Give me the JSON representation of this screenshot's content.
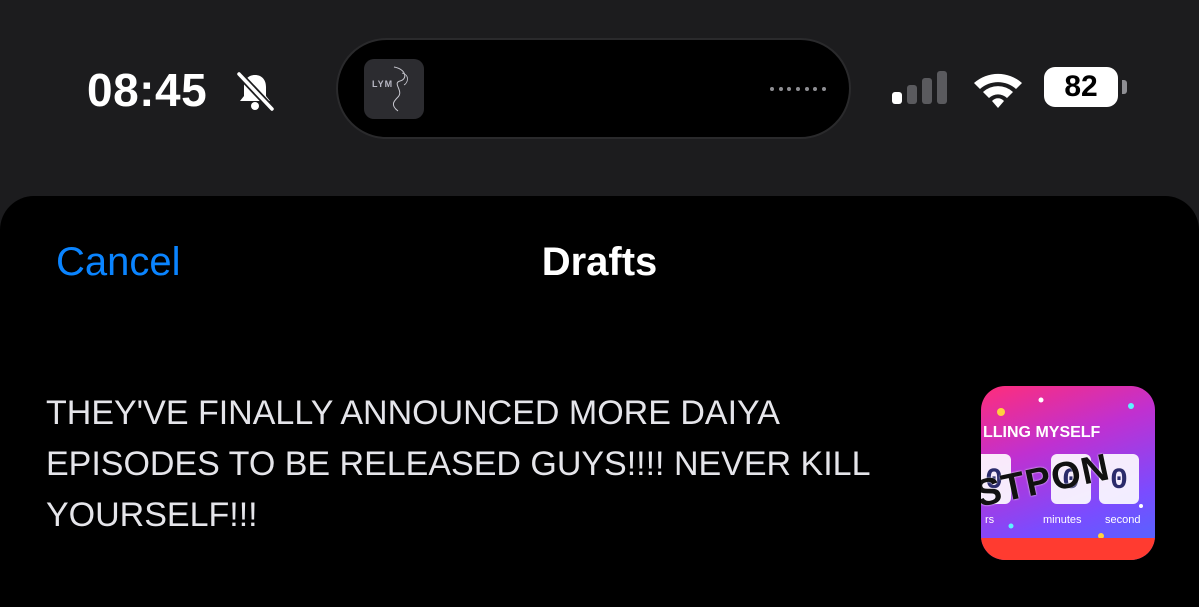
{
  "status_bar": {
    "time": "08:45",
    "battery": "82",
    "island_art_text": "LYM"
  },
  "sheet": {
    "cancel_label": "Cancel",
    "title": "Drafts"
  },
  "draft": {
    "text": "THEY'VE FINALLY ANNOUNCED MORE DAIYA EPISODES TO BE RELEASED GUYS!!!! NEVER KILL YOURSELF!!!",
    "thumbnail": {
      "caption_top": "LLING MYSELF",
      "stamp": "STPON",
      "digits": [
        "0",
        "0",
        "0"
      ],
      "units": [
        "rs",
        "minutes",
        "second"
      ]
    }
  },
  "colors": {
    "accent": "#0a84ff",
    "sheet_bg": "#000000",
    "statusbar_bg": "#1c1c1e"
  }
}
